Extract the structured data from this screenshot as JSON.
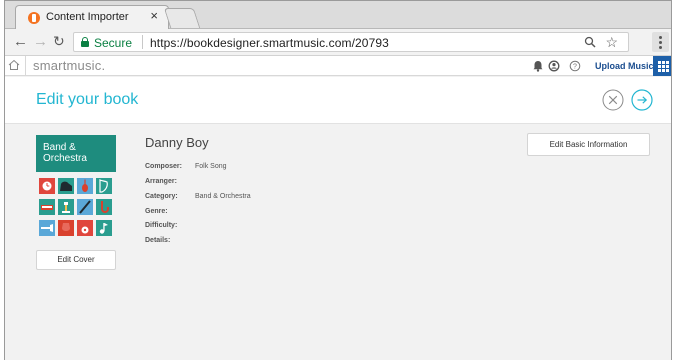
{
  "browser": {
    "tab_title": "Content Importer",
    "tab_close_glyph": "×",
    "secure_label": "Secure",
    "url": "https://bookdesigner.smartmusic.com/20793"
  },
  "app": {
    "brand": "smartmusic.",
    "upload_label": "Upload Music"
  },
  "page": {
    "title": "Edit your book"
  },
  "book": {
    "cover_label": "Band & Orchestra",
    "cover_color": "#1e8c7e",
    "edit_cover_label": "Edit Cover",
    "title": "Danny Boy",
    "edit_info_label": "Edit Basic Information",
    "details": [
      {
        "label": "Composer:",
        "value": "Folk Song"
      },
      {
        "label": "Arranger:",
        "value": ""
      },
      {
        "label": "Category:",
        "value": "Band & Orchestra"
      },
      {
        "label": "Genre:",
        "value": ""
      },
      {
        "label": "Difficulty:",
        "value": ""
      },
      {
        "label": "Details:",
        "value": ""
      }
    ]
  },
  "colors": {
    "accent": "#23b6d1",
    "upload_link": "#1a4d8f",
    "apps_button": "#1d5fa8",
    "secure": "#0b8043"
  }
}
